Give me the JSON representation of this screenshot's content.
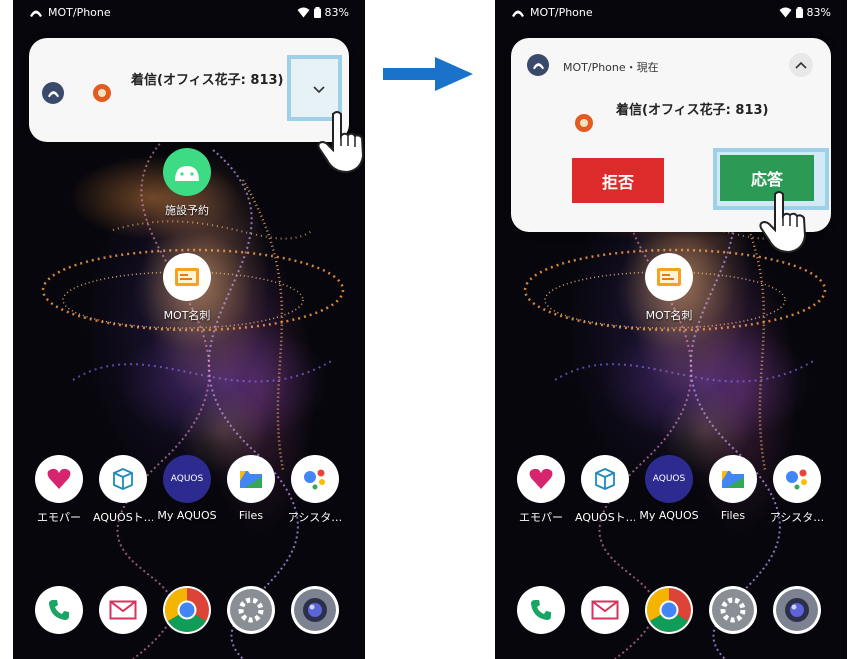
{
  "status": {
    "carrier": "MOT/Phone",
    "battery": "83%"
  },
  "left": {
    "notification": {
      "title": "着信(オフィス花子: 813)"
    },
    "apps": [
      "施設予約",
      "MOT名刺"
    ]
  },
  "right": {
    "notification": {
      "header": "MOT/Phone・現在",
      "title": "着信(オフィス花子: 813)",
      "decline": "拒否",
      "accept": "応答"
    },
    "apps": [
      "MOT名刺"
    ]
  },
  "home_row": [
    "エモパー",
    "AQUOSト…",
    "My AQUOS",
    "Files",
    "アシスタ…"
  ],
  "aquos_icon_text": "AQUOS",
  "colors": {
    "decline": "#dd2b2b",
    "accept": "#2b9a54",
    "highlight": "#9fd0ea",
    "arrow": "#1a73c9"
  },
  "icons": [
    "phone-icon",
    "mail-icon",
    "chrome-icon",
    "settings-icon",
    "camera-icon"
  ]
}
